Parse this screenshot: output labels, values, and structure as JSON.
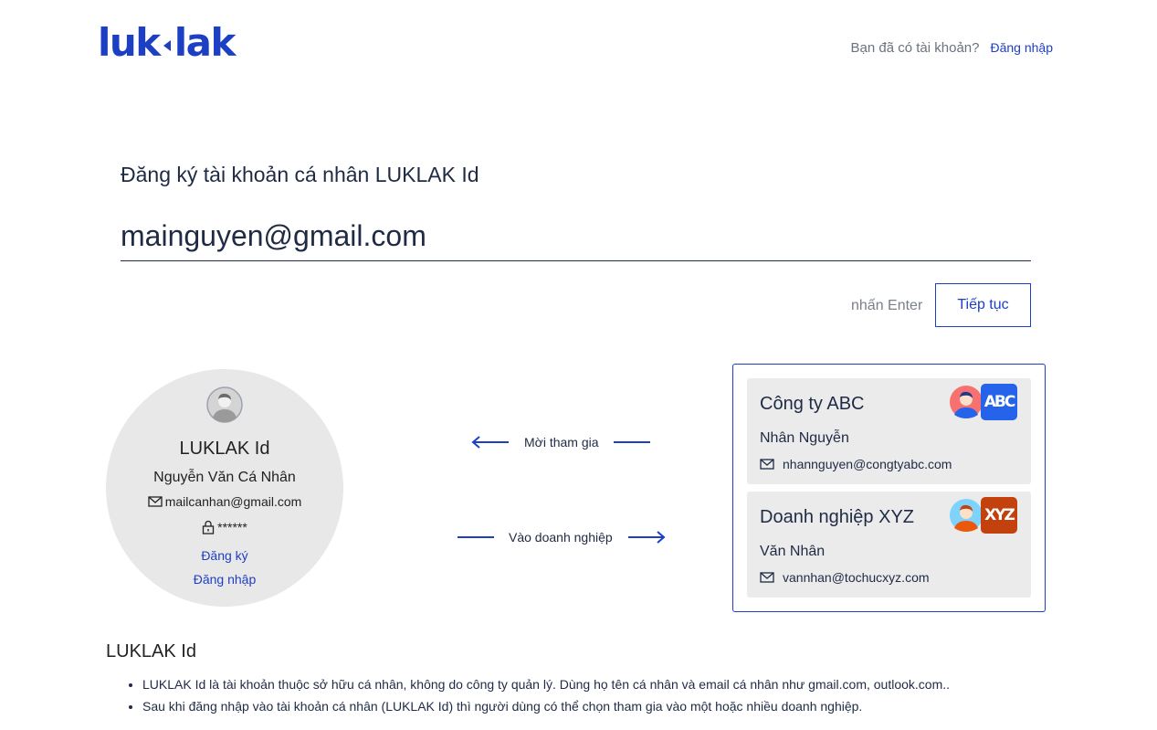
{
  "header": {
    "logo_left": "luk",
    "logo_right": "lak",
    "have_account": "Bạn đã có tài khoản?",
    "login_link": "Đăng nhập"
  },
  "form": {
    "title": "Đăng ký tài khoản cá nhân LUKLAK Id",
    "email_value": "mainguyen@gmail.com",
    "enter_hint": "nhấn Enter",
    "continue_label": "Tiếp tục"
  },
  "personal": {
    "title": "LUKLAK Id",
    "name": "Nguyễn Văn Cá Nhân",
    "email": "mailcanhan@gmail.com",
    "password": "******",
    "register_link": "Đăng ký",
    "login_link": "Đăng nhập"
  },
  "arrows": {
    "invite": "Mời tham gia",
    "enter_org": "Vào doanh nghiệp"
  },
  "orgs": [
    {
      "name": "Công ty ABC",
      "person": "Nhân Nguyễn",
      "email": "nhannguyen@congtyabc.com",
      "badge": "ABC",
      "badge_color": "#2563eb"
    },
    {
      "name": "Doanh nghiệp XYZ",
      "person": "Văn Nhân",
      "email": "vannhan@tochucxyz.com",
      "badge": "XYZ",
      "badge_color": "#c2410c"
    }
  ],
  "info": {
    "title": "LUKLAK Id",
    "bullets": [
      "LUKLAK Id là tài khoản thuộc sở hữu cá nhân, không do công ty quản lý. Dùng họ tên cá nhân và email cá nhân như gmail.com, outlook.com..",
      "Sau khi đăng nhập vào tài khoản cá nhân (LUKLAK Id) thì người dùng có thể chọn tham gia vào một hoặc nhiều doanh nghiệp."
    ]
  },
  "colors": {
    "brand": "#1d3fc4",
    "text": "#1f2a44",
    "card_bg": "#ebebeb"
  }
}
